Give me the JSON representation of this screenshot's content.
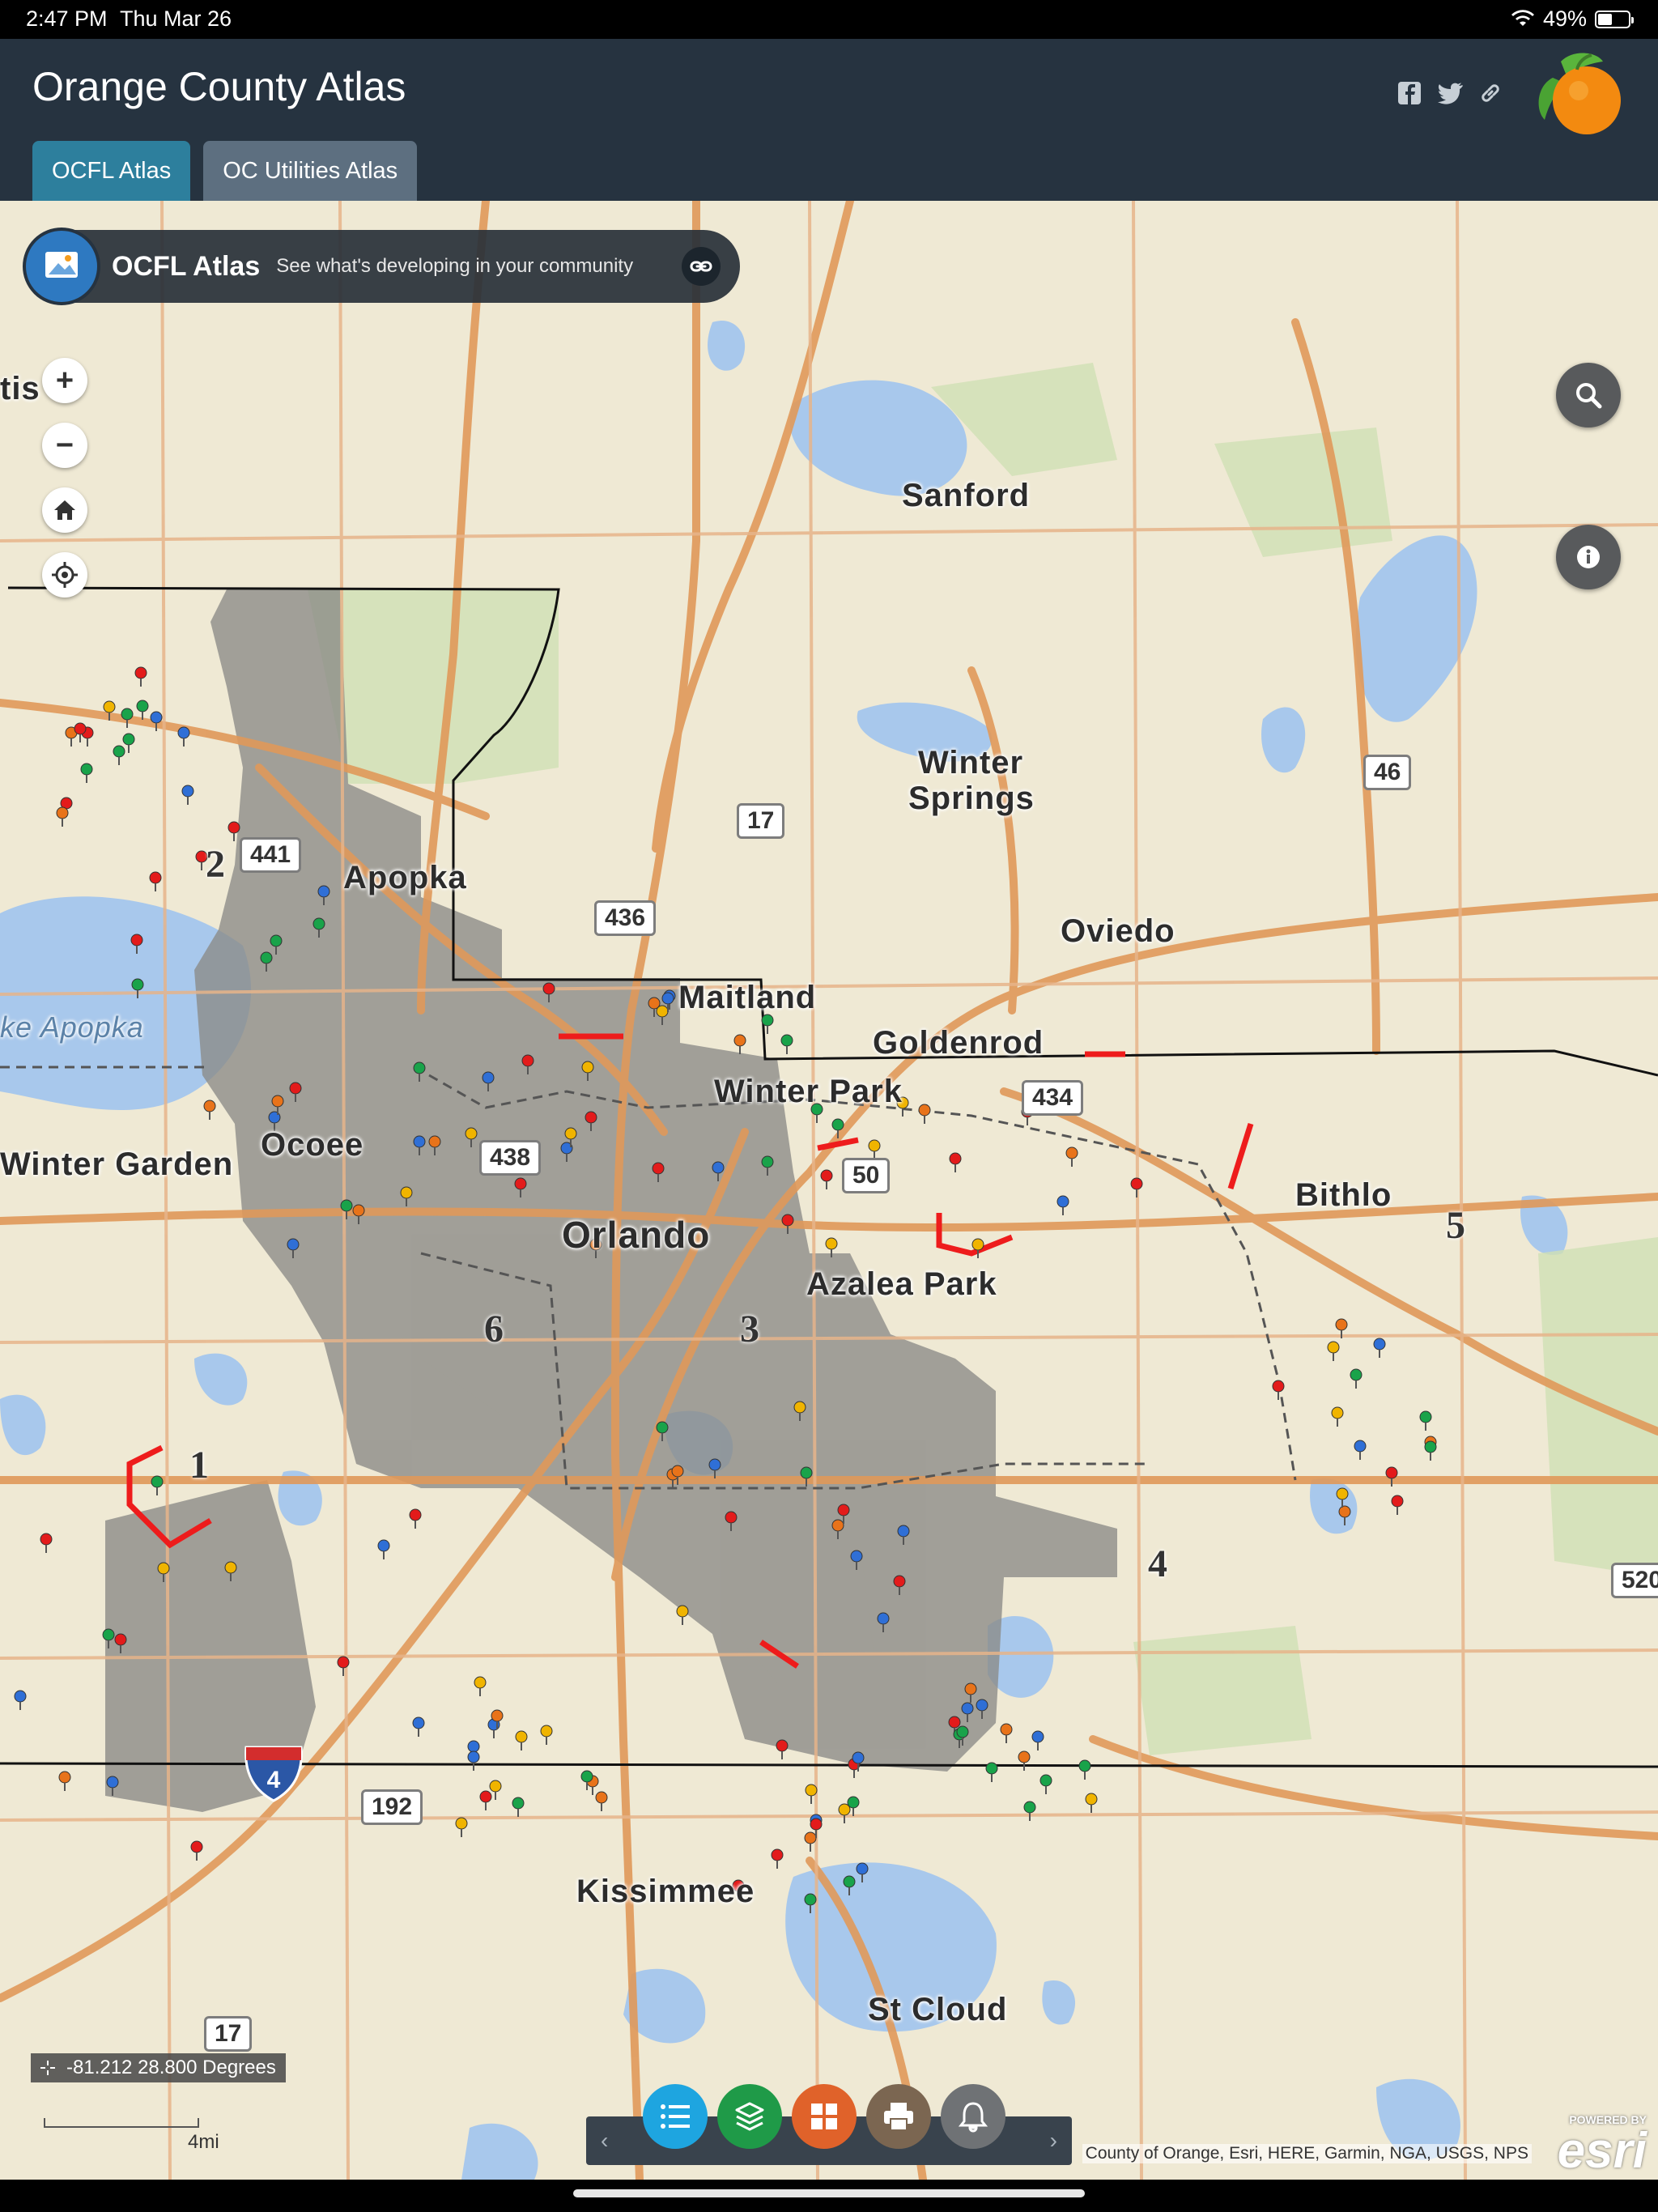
{
  "status_bar": {
    "time": "2:47 PM",
    "date": "Thu Mar 26",
    "battery": "49%"
  },
  "header": {
    "title": "Orange County Atlas",
    "tabs": [
      {
        "label": "OCFL Atlas",
        "active": true
      },
      {
        "label": "OC Utilities Atlas",
        "active": false
      }
    ],
    "social_icons": [
      "facebook-icon",
      "twitter-icon",
      "link-icon"
    ],
    "logo": "orange-logo"
  },
  "banner": {
    "name": "OCFL Atlas",
    "tagline": "See what's developing in your community",
    "link_icon": "link-icon"
  },
  "map_controls": {
    "zoom_in": "+",
    "zoom_out": "−",
    "home_icon": "home-icon",
    "locate_icon": "locate-icon",
    "search_icon": "search-icon",
    "info_icon": "info-icon"
  },
  "places": {
    "sanford": "Sanford",
    "winter_springs_1": "Winter",
    "winter_springs_2": "Springs",
    "apopka": "Apopka",
    "oviedo": "Oviedo",
    "maitland": "Maitland",
    "goldenrod": "Goldenrod",
    "winter_park": "Winter Park",
    "ocoee": "Ocoee",
    "winter_garden": "Winter Garden",
    "orlando": "Orlando",
    "azalea_park": "Azalea Park",
    "bithlo": "Bithlo",
    "kissimmee": "Kissimmee",
    "st_cloud": "St Cloud",
    "lake_apopka": "ke Apopka",
    "edge_left": "tis"
  },
  "districts": [
    "1",
    "2",
    "3",
    "4",
    "5",
    "6"
  ],
  "shields": {
    "us17_north": "17",
    "sr46": "46",
    "sr436": "436",
    "sr441": "441",
    "sr434": "434",
    "sr438": "438",
    "sr50": "50",
    "us192": "192",
    "i4": "4",
    "us17_south": "17",
    "sr520": "520"
  },
  "coordinates": {
    "text": "-81.212 28.800 Degrees"
  },
  "scale": {
    "label": "4mi"
  },
  "toolbar": {
    "prev": "‹",
    "next": "›",
    "tools": [
      {
        "name": "legend-icon",
        "color": "#1ea5e0"
      },
      {
        "name": "layers-icon",
        "color": "#1f9a48"
      },
      {
        "name": "basemap-gallery-icon",
        "color": "#e0622a"
      },
      {
        "name": "print-icon",
        "color": "#7b6651"
      },
      {
        "name": "alert-bell-icon",
        "color": "#6f7275"
      }
    ]
  },
  "attribution": "County of Orange, Esri, HERE, Garmin, NGA, USGS, NPS",
  "esri": {
    "powered": "POWERED BY",
    "brand": "esri"
  },
  "colors": {
    "header_bg": "#263340",
    "tab_active": "#2d7f9d",
    "tab_inactive": "#5d6f80",
    "map_bg": "#efe9d4",
    "water": "#a8c8ec",
    "roads": "#e0995a",
    "county_shade": "#8a8a86"
  }
}
